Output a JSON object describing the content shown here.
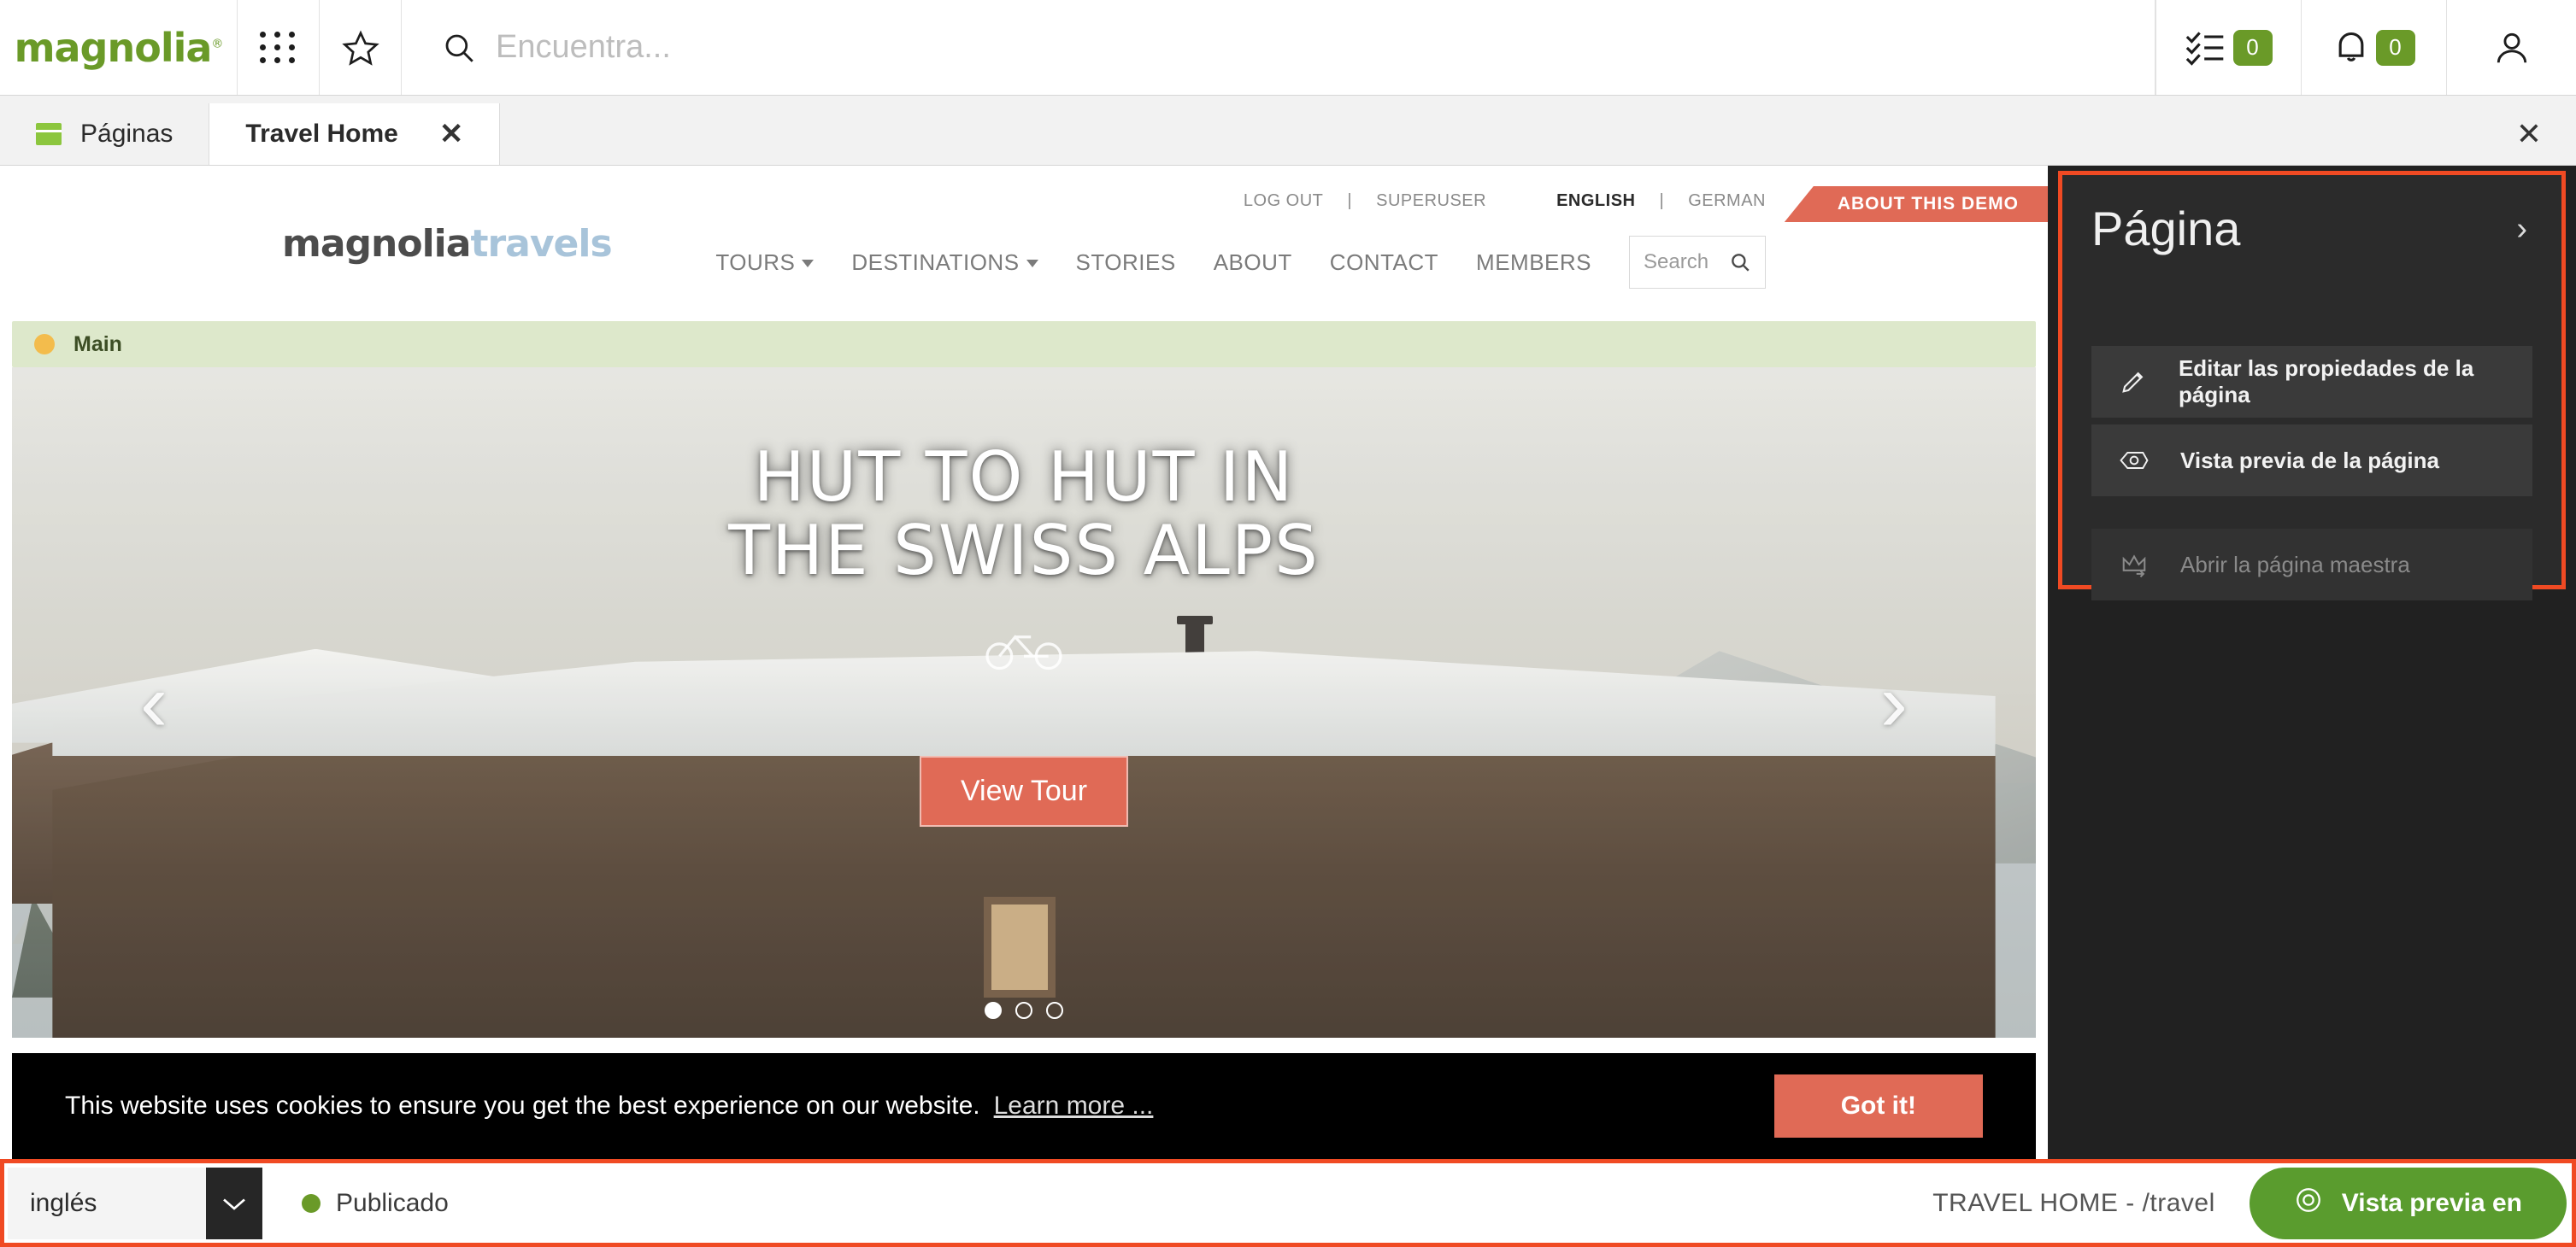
{
  "appbar": {
    "logo_text": "magnolia",
    "logo_mark": "®",
    "apps_icon": "apps-grid-icon",
    "favorites_icon": "star-icon",
    "search_icon": "search-icon",
    "search_placeholder": "Encuentra...",
    "search_value": "",
    "tasks_icon": "tasks-checklist-icon",
    "tasks_count": "0",
    "notifications_icon": "bell-icon",
    "notifications_count": "0",
    "user_icon": "user-avatar-icon",
    "badge_color": "#6a9a28"
  },
  "tabs": {
    "items": [
      {
        "label": "Páginas",
        "icon": "pages-icon",
        "active": false
      },
      {
        "label": "Travel Home",
        "icon": "",
        "active": true
      }
    ],
    "tab_close_label": "✕",
    "bar_close_label": "✕"
  },
  "site": {
    "logo_dark": "magnolia",
    "logo_light": "travels",
    "utility": {
      "logout": "LOG OUT",
      "sep1": "|",
      "user": "SUPERUSER",
      "lang_active": "ENGLISH",
      "sep2": "|",
      "lang_other": "GERMAN"
    },
    "demo_ribbon": "ABOUT THIS DEMO",
    "nav": [
      {
        "label": "TOURS",
        "has_caret": true
      },
      {
        "label": "DESTINATIONS",
        "has_caret": true
      },
      {
        "label": "STORIES",
        "has_caret": false
      },
      {
        "label": "ABOUT",
        "has_caret": false
      },
      {
        "label": "CONTACT",
        "has_caret": false
      },
      {
        "label": "MEMBERS",
        "has_caret": false
      }
    ],
    "search_placeholder": "Search",
    "search_icon": "search-icon"
  },
  "area": {
    "label": "Main",
    "status_color": "#f3bc4c"
  },
  "hero": {
    "title_line1": "HUT TO HUT IN",
    "title_line2": "THE SWISS ALPS",
    "button_label": "View Tour",
    "prev_label": "‹",
    "next_label": "›",
    "bike_icon": "bicycle-icon",
    "slides_total": 3,
    "active_slide": 1
  },
  "cookie": {
    "message": "This website uses cookies to ensure you get the best experience on our website.",
    "link": "Learn more ...",
    "button": "Got it!",
    "button_color": "#e06a56"
  },
  "rail": {
    "title": "Página",
    "expand_icon": "chevron-right-icon",
    "highlight_color": "#f04a23",
    "actions": [
      {
        "label": "Editar las propiedades de la página",
        "icon": "pencil-icon",
        "disabled": false
      },
      {
        "label": "Vista previa de la página",
        "icon": "eye-icon",
        "disabled": false
      },
      {
        "label": "Abrir la página maestra",
        "icon": "crown-arrow-icon",
        "disabled": true
      }
    ]
  },
  "statusbar": {
    "language_value": "inglés",
    "language_caret": "⌄",
    "publish_status": "Publicado",
    "publish_color": "#6a9a28",
    "page_path": "TRAVEL HOME - /travel",
    "preview_button": "Vista previa en",
    "preview_icon": "eye-target-icon",
    "preview_color": "#5a9c2e",
    "highlight_color": "#f04a23"
  }
}
